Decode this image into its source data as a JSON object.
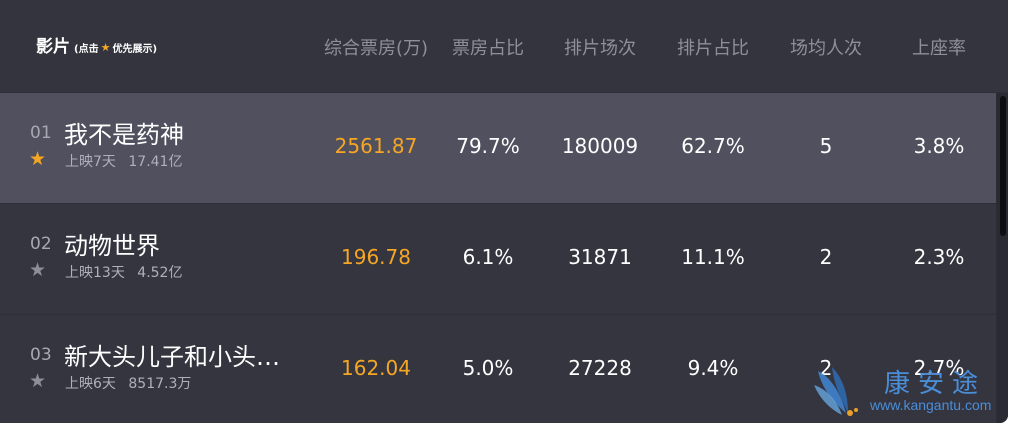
{
  "header": {
    "title": "影片",
    "hint_prefix": "(点击",
    "hint_suffix": "优先展示)",
    "columns": [
      "综合票房(万)",
      "票房占比",
      "排片场次",
      "排片占比",
      "场均人次",
      "上座率"
    ]
  },
  "rows": [
    {
      "rank": "01",
      "name": "我不是药神",
      "starred": true,
      "days": "上映7天",
      "total": "17.41亿",
      "box_office": "2561.87",
      "box_share": "79.7%",
      "shows": "180009",
      "show_share": "62.7%",
      "avg_people": "5",
      "occupancy": "3.8%"
    },
    {
      "rank": "02",
      "name": "动物世界",
      "starred": false,
      "days": "上映13天",
      "total": "4.52亿",
      "box_office": "196.78",
      "box_share": "6.1%",
      "shows": "31871",
      "show_share": "11.1%",
      "avg_people": "2",
      "occupancy": "2.3%"
    },
    {
      "rank": "03",
      "name": "新大头儿子和小头…",
      "starred": false,
      "days": "上映6天",
      "total": "8517.3万",
      "box_office": "162.04",
      "box_share": "5.0%",
      "shows": "27228",
      "show_share": "9.4%",
      "avg_people": "2",
      "occupancy": "2.7%"
    }
  ],
  "watermark": {
    "chinese": "康安途",
    "url": "www.kangantu.com"
  },
  "colors": {
    "accent": "#f5a623",
    "header_bg": "#34343e",
    "selected_row_bg": "#50505f",
    "row_bg": "#353540",
    "watermark": "#4a8ed8"
  }
}
